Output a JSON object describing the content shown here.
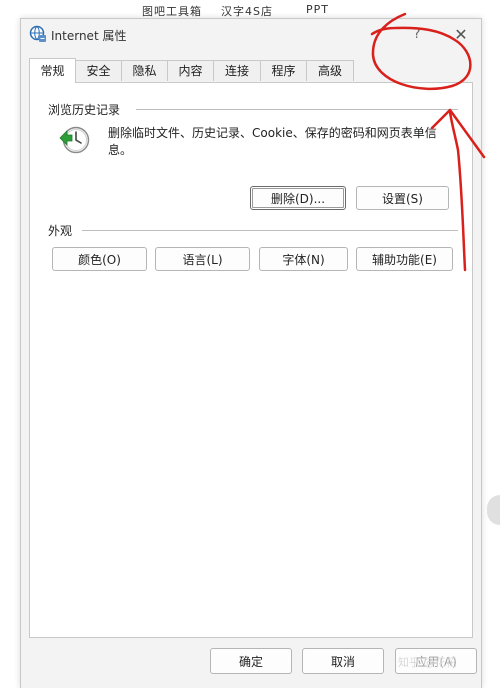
{
  "taskbar": {
    "items": [
      "图吧工具箱",
      "汉字4S店",
      "PPT"
    ]
  },
  "window": {
    "title": "Internet 属性",
    "help_label": "?",
    "close_label": "✕"
  },
  "tabs": [
    {
      "label": "常规",
      "active": true
    },
    {
      "label": "安全",
      "active": false
    },
    {
      "label": "隐私",
      "active": false
    },
    {
      "label": "内容",
      "active": false
    },
    {
      "label": "连接",
      "active": false
    },
    {
      "label": "程序",
      "active": false
    },
    {
      "label": "高级",
      "active": false
    }
  ],
  "browsing_history": {
    "heading": "浏览历史记录",
    "icon": "history-clock-icon",
    "description": "删除临时文件、历史记录、Cookie、保存的密码和网页表单信息。",
    "delete_label": "删除(D)...",
    "settings_label": "设置(S)"
  },
  "appearance": {
    "heading": "外观",
    "colors_label": "颜色(O)",
    "languages_label": "语言(L)",
    "fonts_label": "字体(N)",
    "accessibility_label": "辅助功能(E)"
  },
  "footer": {
    "ok_label": "确定",
    "cancel_label": "取消",
    "apply_label": "应用(A)"
  },
  "watermark": "知乎 @花花",
  "colors": {
    "annotation_red": "#d9201a",
    "dialog_bg": "#f3f3f3",
    "icon_green": "#2e9e3a"
  }
}
